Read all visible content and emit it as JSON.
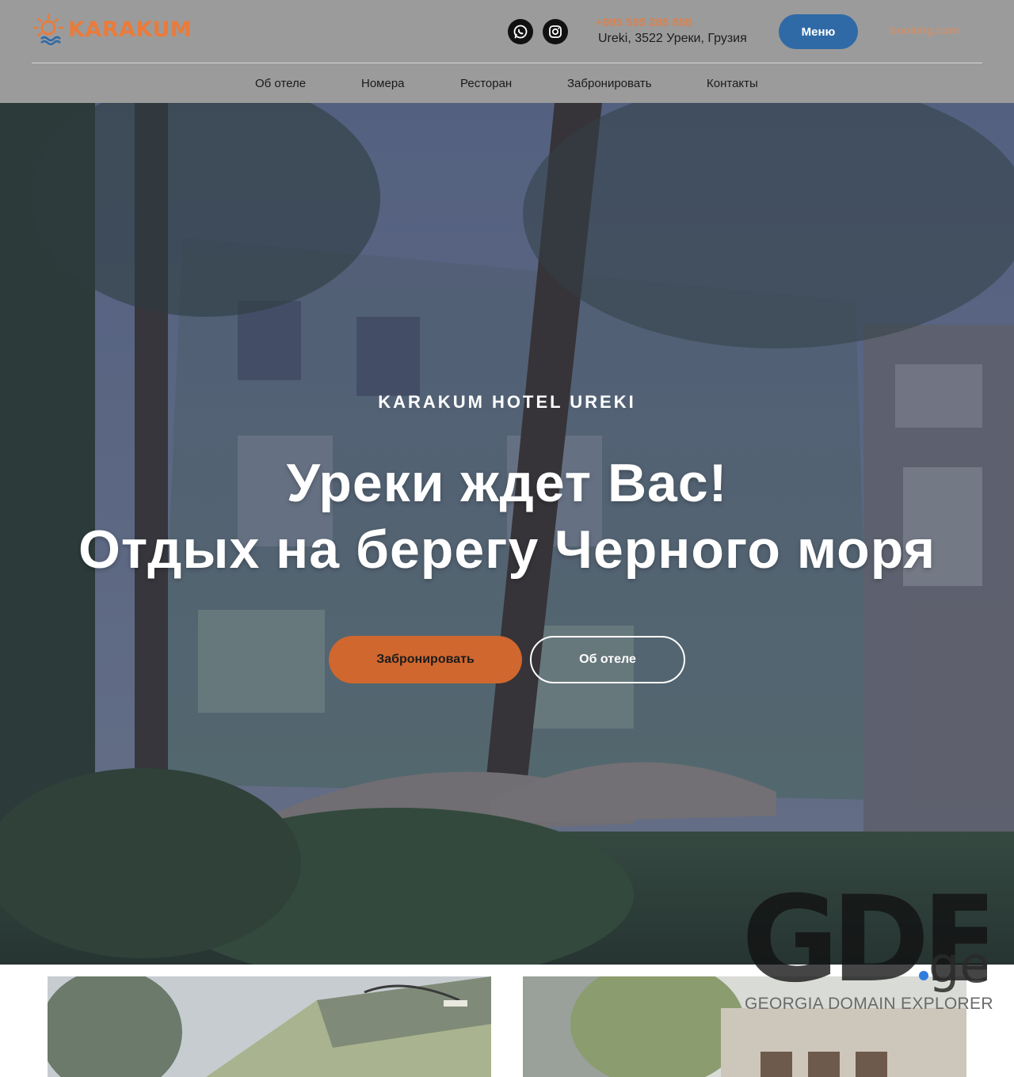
{
  "header": {
    "logo_text": "KARAKUM",
    "phone": "+995 595 288 888",
    "address": "Ureki, 3522 Уреки, Грузия",
    "menu_label": "Меню",
    "booking_link": "booking.com",
    "social": [
      {
        "icon": "whatsapp-icon"
      },
      {
        "icon": "instagram-icon"
      }
    ]
  },
  "nav": {
    "items": [
      {
        "label": "Об отеле"
      },
      {
        "label": "Номера"
      },
      {
        "label": "Ресторан"
      },
      {
        "label": "Забронировать"
      },
      {
        "label": "Контакты"
      }
    ]
  },
  "hero": {
    "eyebrow": "KARAKUM HOTEL UREKI",
    "title_line1": "Уреки ждет Вас!",
    "title_line2": "Отдых на берегу Черного моря",
    "primary_button": "Забронировать",
    "secondary_button": "Об отеле"
  },
  "watermark": {
    "brand": "GDE.ge",
    "tagline": "GEORGIA DOMAIN EXPLORER"
  },
  "colors": {
    "accent": "#d0672e",
    "logo_orange": "#ea7b3b",
    "menu_blue": "#2f6aa6",
    "header_bg": "#9b9b9b"
  }
}
